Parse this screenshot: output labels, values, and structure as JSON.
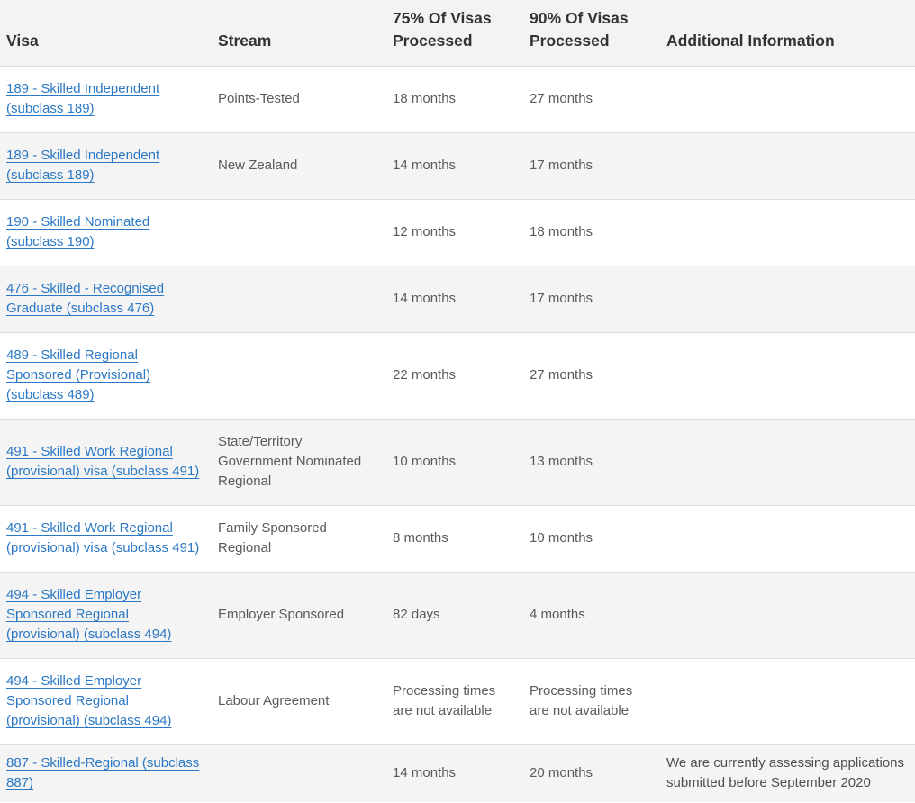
{
  "table": {
    "headers": [
      "Visa",
      "Stream",
      "75% Of Visas Processed",
      "90% Of Visas Processed",
      "Additional Information"
    ],
    "rows": [
      {
        "visa": "189 - Skilled Independent (subclass 189)",
        "stream": "Points-Tested",
        "p75": "18 months",
        "p90": "27 months",
        "info": ""
      },
      {
        "visa": "189 - Skilled Independent (subclass 189)",
        "stream": "New Zealand",
        "p75": "14 months",
        "p90": "17 months",
        "info": ""
      },
      {
        "visa": "190 - Skilled Nominated (subclass 190)",
        "stream": "",
        "p75": "12 months",
        "p90": "18 months",
        "info": ""
      },
      {
        "visa": "476 - Skilled - Recognised Graduate (subclass 476)",
        "stream": "",
        "p75": "14 months",
        "p90": "17 months",
        "info": ""
      },
      {
        "visa": "489 - Skilled Regional Sponsored (Provisional) (subclass 489)",
        "stream": "",
        "p75": "22 months",
        "p90": "27 months",
        "info": ""
      },
      {
        "visa": "491 - Skilled Work Regional (provisional) visa (subclass 491)",
        "stream": "State/Territory Government Nominated Regional",
        "p75": "10 months",
        "p90": "13 months",
        "info": ""
      },
      {
        "visa": "491 - Skilled Work Regional (provisional) visa (subclass 491)",
        "stream": "Family Sponsored Regional",
        "p75": "8 months",
        "p90": "10 months",
        "info": ""
      },
      {
        "visa": "494 - Skilled Employer Sponsored Regional (provisional) (subclass 494)",
        "stream": "Employer Sponsored",
        "p75": "82 days",
        "p90": "4 months",
        "info": ""
      },
      {
        "visa": "494 - Skilled Employer Sponsored Regional (provisional) (subclass 494)",
        "stream": "Labour Agreement",
        "p75": "Processing times are not available",
        "p90": "Processing times are not available",
        "info": ""
      },
      {
        "visa": "887 - Skilled-Regional (subclass 887)",
        "stream": "",
        "p75": "14 months",
        "p90": "20 months",
        "info": "We are currently assessing applications submitted before September 2020"
      }
    ]
  }
}
